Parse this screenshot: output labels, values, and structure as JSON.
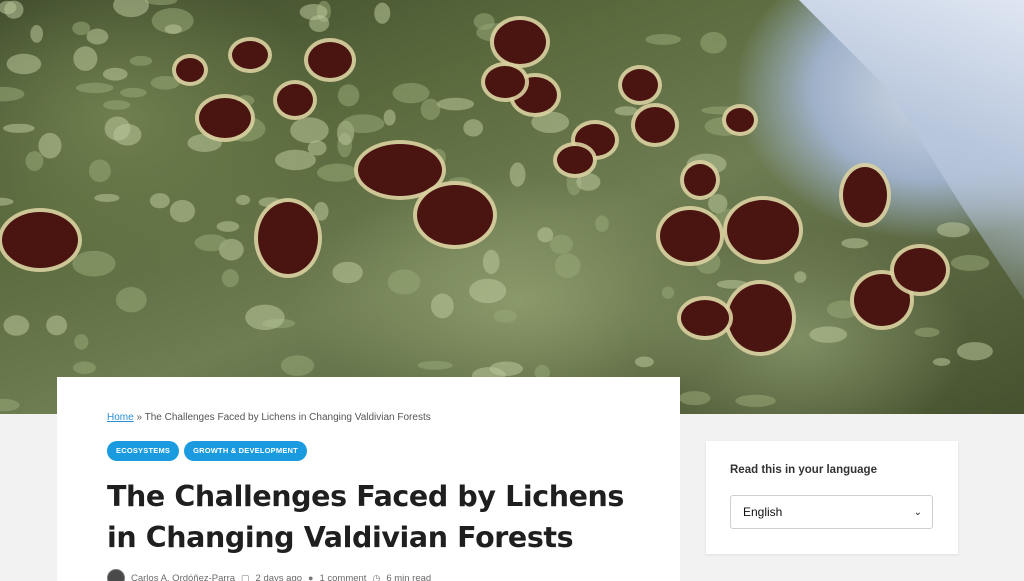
{
  "hero": {
    "image_name": "lichen-hero-image",
    "colors": {
      "moss": "#6e7d52",
      "cup": "#4a1410",
      "rim": "#d9cfa0",
      "sky": "#b8c6dc"
    }
  },
  "article": {
    "breadcrumb": {
      "home": "Home",
      "separator": "»",
      "current": "The Challenges Faced by Lichens in Changing Valdivian Forests"
    },
    "tags": [
      "ECOSYSTEMS",
      "GROWTH & DEVELOPMENT"
    ],
    "title": "The Challenges Faced by Lichens in Changing Valdivian Forests",
    "meta": {
      "author": "Carlos A. Ordóñez-Parra",
      "date": "2 days ago",
      "comments": "1 comment",
      "read_time": "6 min read"
    }
  },
  "sidebar": {
    "language_widget": {
      "title": "Read this in your language",
      "selected": "English"
    }
  },
  "colors": {
    "accent": "#1a9be0",
    "link": "#2a8fd6",
    "background": "#f2f2f2"
  }
}
